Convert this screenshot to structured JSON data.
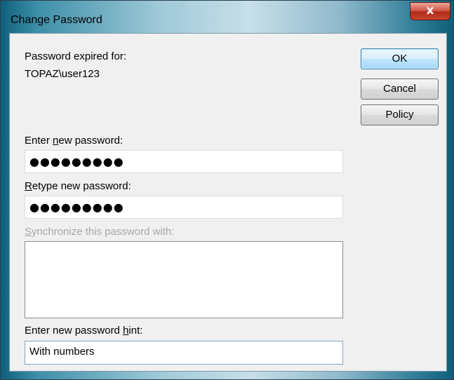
{
  "window": {
    "title": "Change Password",
    "close_glyph": "x"
  },
  "info": {
    "expired_label": "Password expired for:",
    "account": "TOPAZ\\user123"
  },
  "buttons": {
    "ok": "OK",
    "cancel": "Cancel",
    "policy": "Policy"
  },
  "new_password": {
    "label_pre": "Enter ",
    "label_key": "n",
    "label_post": "ew password:",
    "mask": "●●●●●●●●●"
  },
  "retype_password": {
    "label_key": "R",
    "label_post": "etype new password:",
    "mask": "●●●●●●●●●"
  },
  "sync": {
    "label_key": "S",
    "label_post": "ynchronize this password with:",
    "items": []
  },
  "hint": {
    "label_pre": "Enter new password ",
    "label_key": "h",
    "label_post": "int:",
    "value": "With numbers"
  }
}
